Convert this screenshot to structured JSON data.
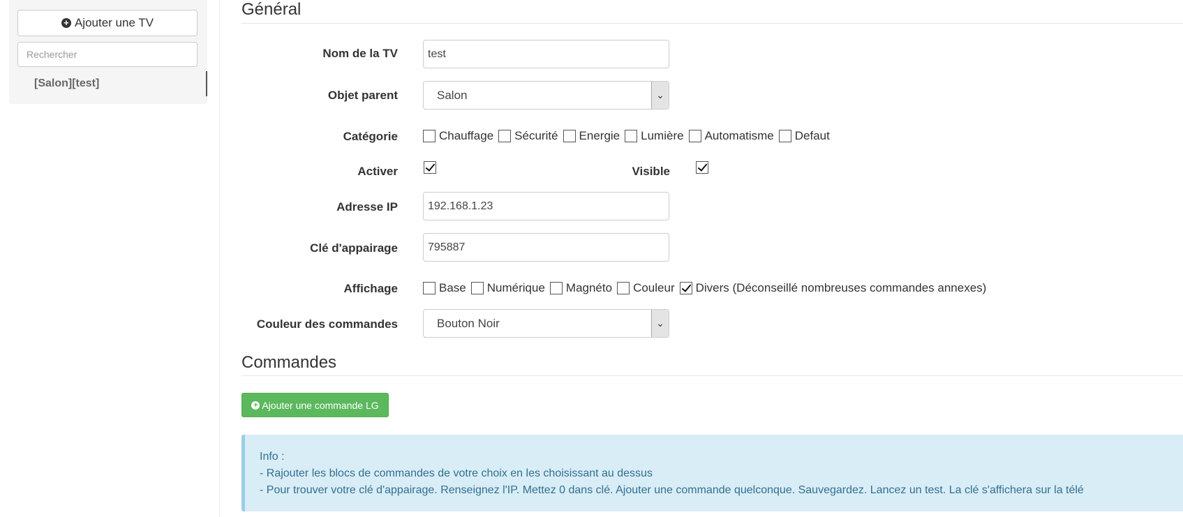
{
  "sidebar": {
    "add_button_label": "Ajouter une TV",
    "search_placeholder": "Rechercher",
    "items": [
      {
        "label": "[Salon][test]"
      }
    ]
  },
  "general": {
    "legend": "Général",
    "tv_name": {
      "label": "Nom de la TV",
      "value": "test"
    },
    "parent": {
      "label": "Objet parent",
      "value": "Salon"
    },
    "category": {
      "label": "Catégorie",
      "options": [
        {
          "label": "Chauffage",
          "checked": false
        },
        {
          "label": "Sécurité",
          "checked": false
        },
        {
          "label": "Energie",
          "checked": false
        },
        {
          "label": "Lumière",
          "checked": false
        },
        {
          "label": "Automatisme",
          "checked": false
        },
        {
          "label": "Defaut",
          "checked": false
        }
      ]
    },
    "enable": {
      "label": "Activer",
      "checked": true
    },
    "visible": {
      "label": "Visible",
      "checked": true
    },
    "ip": {
      "label": "Adresse IP",
      "value": "192.168.1.23"
    },
    "pairing_key": {
      "label": "Clé d'appairage",
      "value": "795887"
    },
    "display": {
      "label": "Affichage",
      "options": [
        {
          "label": "Base",
          "checked": false
        },
        {
          "label": "Numérique",
          "checked": false
        },
        {
          "label": "Magnéto",
          "checked": false
        },
        {
          "label": "Couleur",
          "checked": false
        },
        {
          "label": "Divers (Déconseillé nombreuses commandes annexes)",
          "checked": true
        }
      ]
    },
    "cmd_color": {
      "label": "Couleur des commandes",
      "value": "Bouton Noir"
    }
  },
  "commands": {
    "legend": "Commandes",
    "add_button_label": "Ajouter une commande LG",
    "info": {
      "title": "Info :",
      "lines": [
        "- Rajouter les blocs de commandes de votre choix en les choisissant au dessus",
        "- Pour trouver votre clé d'appairage. Renseignez l'IP. Mettez 0 dans clé. Ajouter une commande quelconque. Sauvegardez. Lancez un test. La clé s'affichera sur la télé"
      ]
    }
  },
  "colors": {
    "success": "#5cb85c",
    "info_bg": "#d9edf7",
    "info_text": "#31708f"
  },
  "icons": {
    "add": "plus-circle-icon",
    "dropdown": "chevron-down-icon",
    "check": "checkmark-icon"
  }
}
